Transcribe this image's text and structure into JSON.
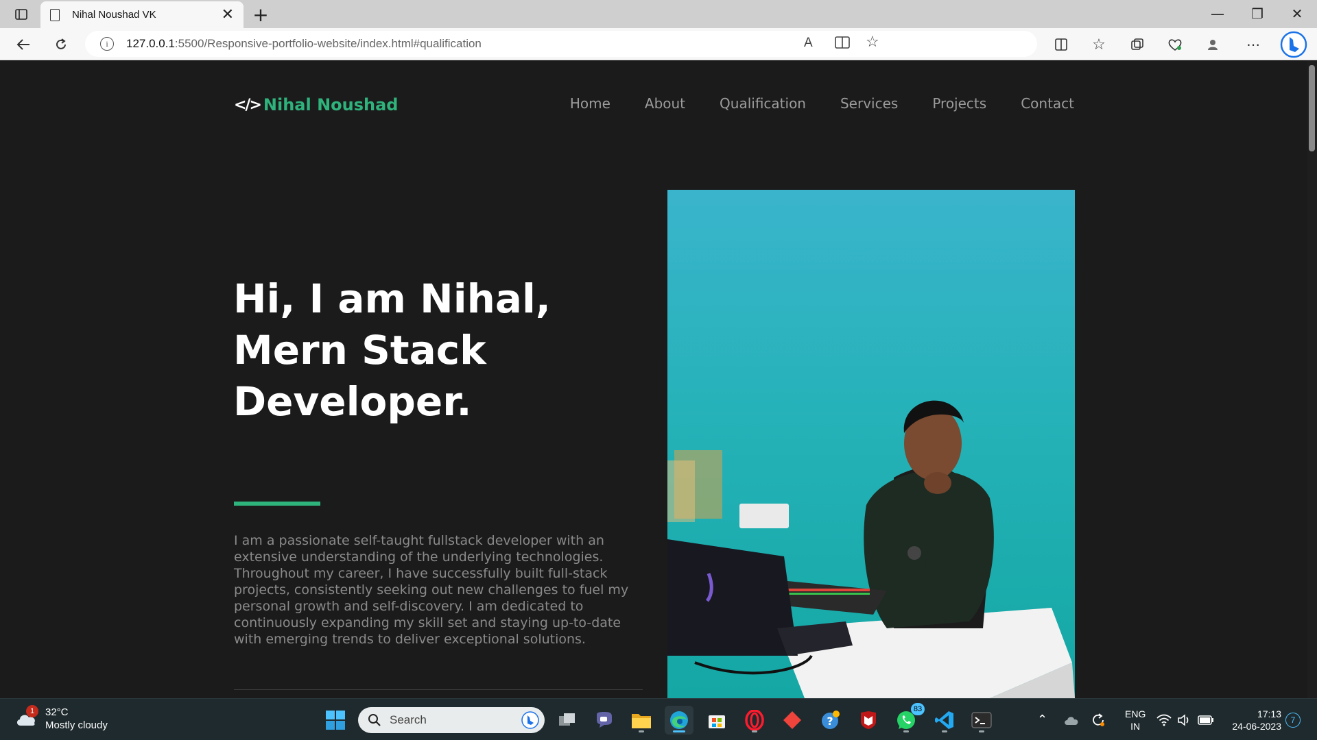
{
  "browser": {
    "tab_title": "Nihal Noushad VK",
    "tab_close": "✕",
    "new_tab": "+",
    "url_host": "127.0.0.1",
    "url_rest": ":5500/Responsive-portfolio-website/index.html#qualification",
    "read_aloud": "A",
    "window": {
      "minimize": "—",
      "maximize": "❐",
      "close": "✕"
    }
  },
  "site": {
    "logo_mark": "</>",
    "logo_text": "Nihal Noushad",
    "nav": [
      "Home",
      "About",
      "Qualification",
      "Services",
      "Projects",
      "Contact"
    ],
    "hero": {
      "line1": "Hi, I am Nihal,",
      "line2": "Mern Stack",
      "line3": "Developer.",
      "description": "I am a passionate self-taught fullstack developer with an extensive understanding of the underlying technologies. Throughout my career, I have successfully built full-stack projects, consistently seeking out new challenges to fuel my personal growth and self-discovery. I am dedicated to continuously expanding my skill set and staying up-to-date with emerging trends to deliver exceptional solutions."
    },
    "colors": {
      "accent": "#2fb37c",
      "background": "#1b1b1b"
    }
  },
  "taskbar": {
    "weather_temp": "32°C",
    "weather_desc": "Mostly cloudy",
    "weather_badge": "1",
    "search_label": "Search",
    "whatsapp_badge": "83",
    "lang_line1": "ENG",
    "lang_line2": "IN",
    "time": "17:13",
    "date": "24-06-2023",
    "notifications": "7"
  }
}
